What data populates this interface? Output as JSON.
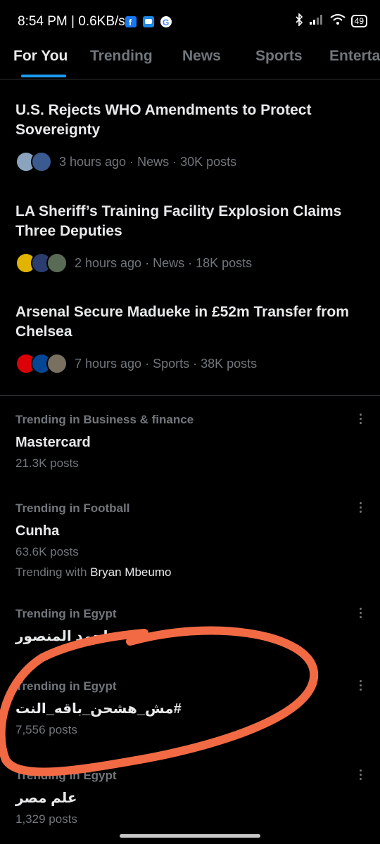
{
  "status_bar": {
    "time": "8:54 PM | 0.6KB/s",
    "battery": "49",
    "icons": [
      "facebook-icon",
      "messenger-icon",
      "google-icon",
      "bluetooth-icon",
      "signal-icon",
      "wifi-icon",
      "battery-icon"
    ]
  },
  "tabs": [
    {
      "label": "For You",
      "active": true
    },
    {
      "label": "Trending"
    },
    {
      "label": "News"
    },
    {
      "label": "Sports"
    },
    {
      "label": "Enterta"
    }
  ],
  "news": [
    {
      "title": "U.S. Rejects WHO Amendments to Protect Sovereignty",
      "meta": "3 hours ago · News · 30K posts"
    },
    {
      "title": "LA Sheriff’s Training Facility Explosion Claims Three Deputies",
      "meta": "2 hours ago · News · 18K posts"
    },
    {
      "title": "Arsenal Secure Madueke in £52m Transfer from Chelsea",
      "meta": "7 hours ago · Sports · 38K posts"
    }
  ],
  "trends": [
    {
      "context": "Trending in Business & finance",
      "name": "Mastercard",
      "count": "21.3K posts"
    },
    {
      "context": "Trending in Football",
      "name": "Cunha",
      "count": "63.6K posts",
      "with_label": "Trending with",
      "with_name": "Bryan Mbeumo"
    },
    {
      "context": "Trending in Egypt",
      "name": "احمد المنصور"
    },
    {
      "context": "Trending in Egypt",
      "name": "#مش_هشحن_باقه_النت",
      "count": "7,556 posts"
    },
    {
      "context": "Trending in Egypt",
      "name": "علم مصر",
      "count": "1,329 posts"
    }
  ],
  "colors": {
    "background": "#000000",
    "primary_text": "#e7e9ea",
    "secondary_text": "#71767b",
    "accent": "#1d9bf0",
    "annotation": "#f26a44"
  }
}
